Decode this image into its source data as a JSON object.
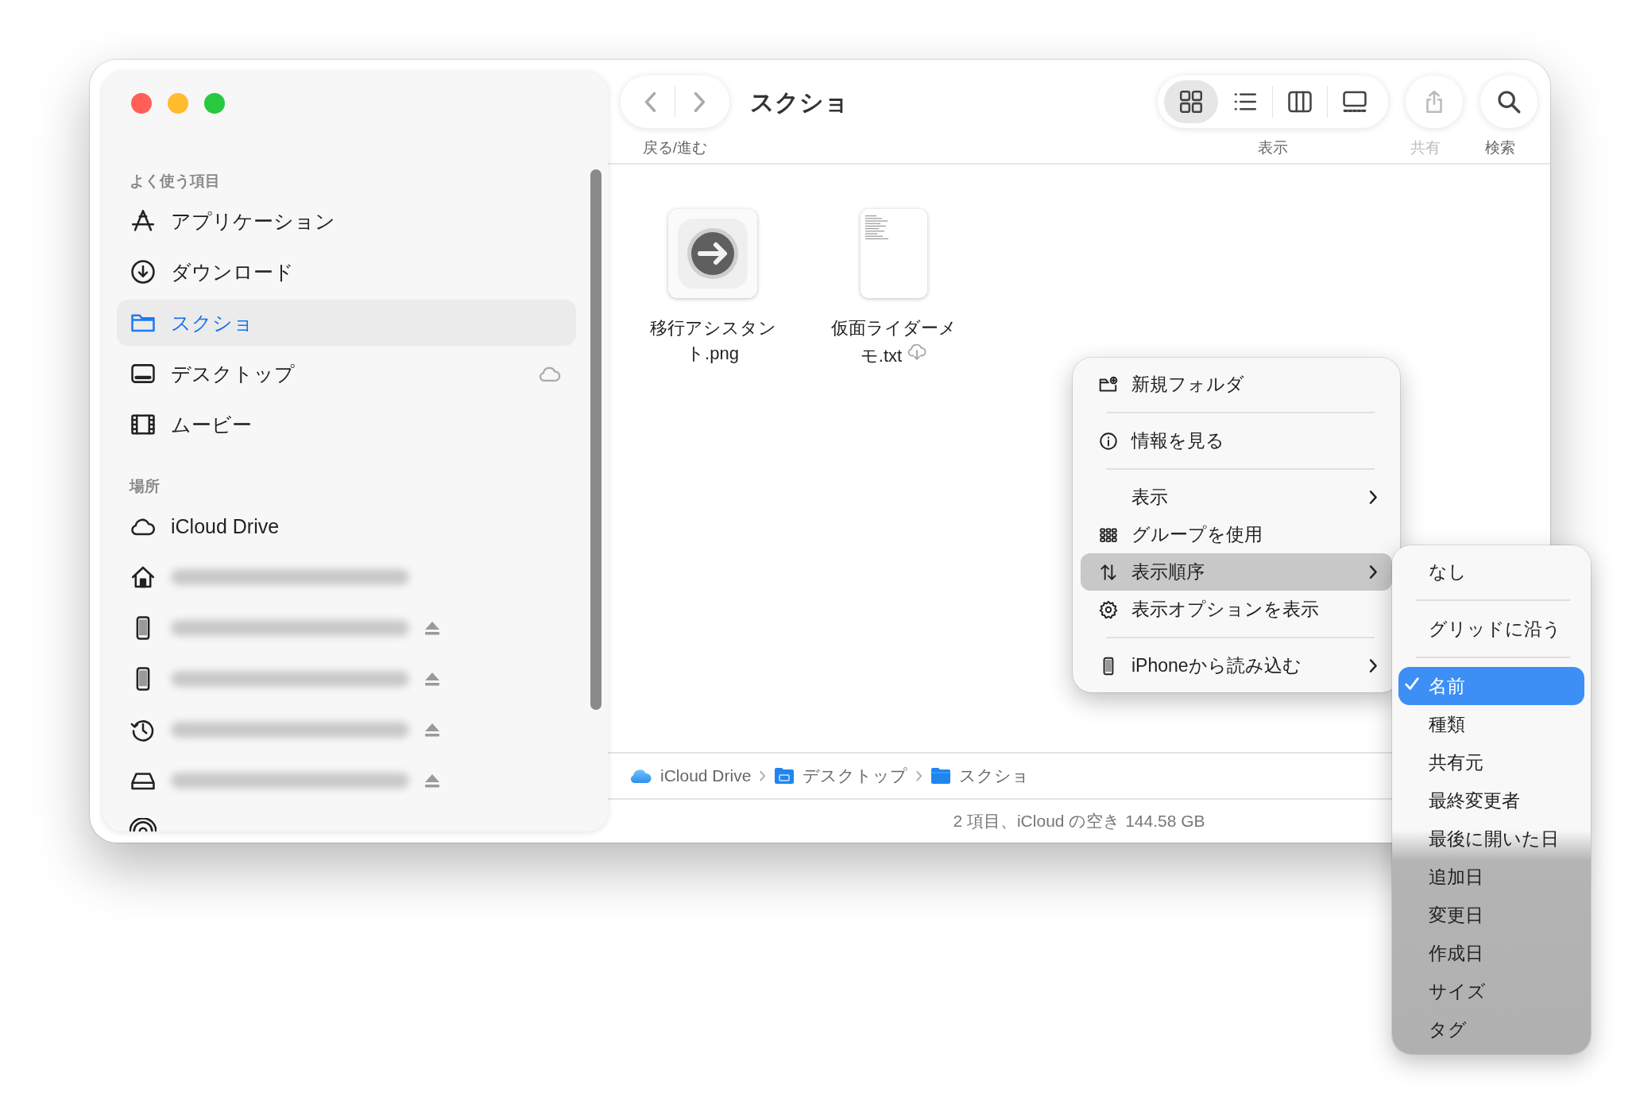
{
  "window": {
    "traffic_lights": [
      {
        "color": "#ff5f57"
      },
      {
        "color": "#febc2e"
      },
      {
        "color": "#28c840"
      }
    ]
  },
  "sidebar": {
    "sections": [
      {
        "heading": "よく使う項目",
        "items": [
          {
            "kind": "apps",
            "label": "アプリケーション",
            "selected": false,
            "in_cloud": false
          },
          {
            "kind": "download",
            "label": "ダウンロード",
            "selected": false,
            "in_cloud": false
          },
          {
            "kind": "folder",
            "label": "スクショ",
            "selected": true,
            "in_cloud": false
          },
          {
            "kind": "desktop",
            "label": "デスクトップ",
            "selected": false,
            "in_cloud": true
          },
          {
            "kind": "film",
            "label": "ムービー",
            "selected": false,
            "in_cloud": false
          }
        ]
      },
      {
        "heading": "場所",
        "items": [
          {
            "kind": "cloud",
            "label": "iCloud Drive",
            "selected": false,
            "in_cloud": false
          },
          {
            "kind": "home",
            "eject": false
          },
          {
            "kind": "phone",
            "eject": true
          },
          {
            "kind": "phone",
            "eject": true
          },
          {
            "kind": "clock",
            "eject": true
          },
          {
            "kind": "drive",
            "eject": true
          },
          {
            "kind": "airdrop"
          }
        ]
      }
    ]
  },
  "toolbar": {
    "nav_label": "戻る/進む",
    "title": "スクショ",
    "view_label": "表示",
    "view_modes": [
      {
        "kind": "grid",
        "selected": true
      },
      {
        "kind": "list",
        "selected": false
      },
      {
        "kind": "columns",
        "selected": false
      },
      {
        "kind": "gallery",
        "selected": false
      }
    ],
    "share_label": "共有",
    "share_disabled": true,
    "search_label": "検索"
  },
  "files": [
    {
      "name": "移行アシスタント.png",
      "in_cloud": false
    },
    {
      "kind": "text",
      "name": "仮面ライダーメモ.txt",
      "in_cloud": true
    }
  ],
  "context_menu": [
    {
      "kind": "new-folder",
      "label": "新規フォルダ",
      "submenu": false,
      "selected": false,
      "separator_after": true
    },
    {
      "kind": "info",
      "label": "情報を見る",
      "submenu": false,
      "selected": false,
      "separator_after": true
    },
    {
      "kind": "plain",
      "label": "表示",
      "submenu": true,
      "selected": false,
      "separator_after": false
    },
    {
      "kind": "group",
      "label": "グループを使用",
      "submenu": false,
      "selected": false,
      "separator_after": false
    },
    {
      "kind": "sort",
      "label": "表示順序",
      "submenu": true,
      "selected": true,
      "separator_after": false
    },
    {
      "kind": "gear",
      "label": "表示オプションを表示",
      "submenu": false,
      "selected": false,
      "separator_after": true
    },
    {
      "kind": "phone",
      "label": "iPhoneから読み込む",
      "submenu": true,
      "selected": false,
      "separator_after": false
    }
  ],
  "sort_menu": [
    {
      "label": "なし",
      "checked": false,
      "selected": false,
      "separator_after": true
    },
    {
      "label": "グリッドに沿う",
      "checked": false,
      "selected": false,
      "separator_after": true
    },
    {
      "label": "名前",
      "checked": true,
      "selected": true,
      "separator_after": false
    },
    {
      "label": "種類",
      "checked": false,
      "selected": false,
      "separator_after": false
    },
    {
      "label": "共有元",
      "checked": false,
      "selected": false,
      "separator_after": false
    },
    {
      "label": "最終変更者",
      "checked": false,
      "selected": false,
      "separator_after": false
    },
    {
      "label": "最後に開いた日",
      "checked": false,
      "selected": false,
      "separator_after": false
    },
    {
      "label": "追加日",
      "checked": false,
      "selected": false,
      "separator_after": false
    },
    {
      "label": "変更日",
      "checked": false,
      "selected": false,
      "separator_after": false
    },
    {
      "label": "作成日",
      "checked": false,
      "selected": false,
      "separator_after": false
    },
    {
      "label": "サイズ",
      "checked": false,
      "selected": false,
      "separator_after": false
    },
    {
      "label": "タグ",
      "checked": false,
      "selected": false,
      "separator_after": false
    }
  ],
  "path_bar": [
    {
      "kind": "cloud",
      "label": "iCloud Drive"
    },
    {
      "kind": "desktop-folder",
      "label": "デスクトップ"
    },
    {
      "kind": "folder",
      "label": "スクショ"
    }
  ],
  "status_bar": "2 項目、iCloud の空き 144.58 GB"
}
